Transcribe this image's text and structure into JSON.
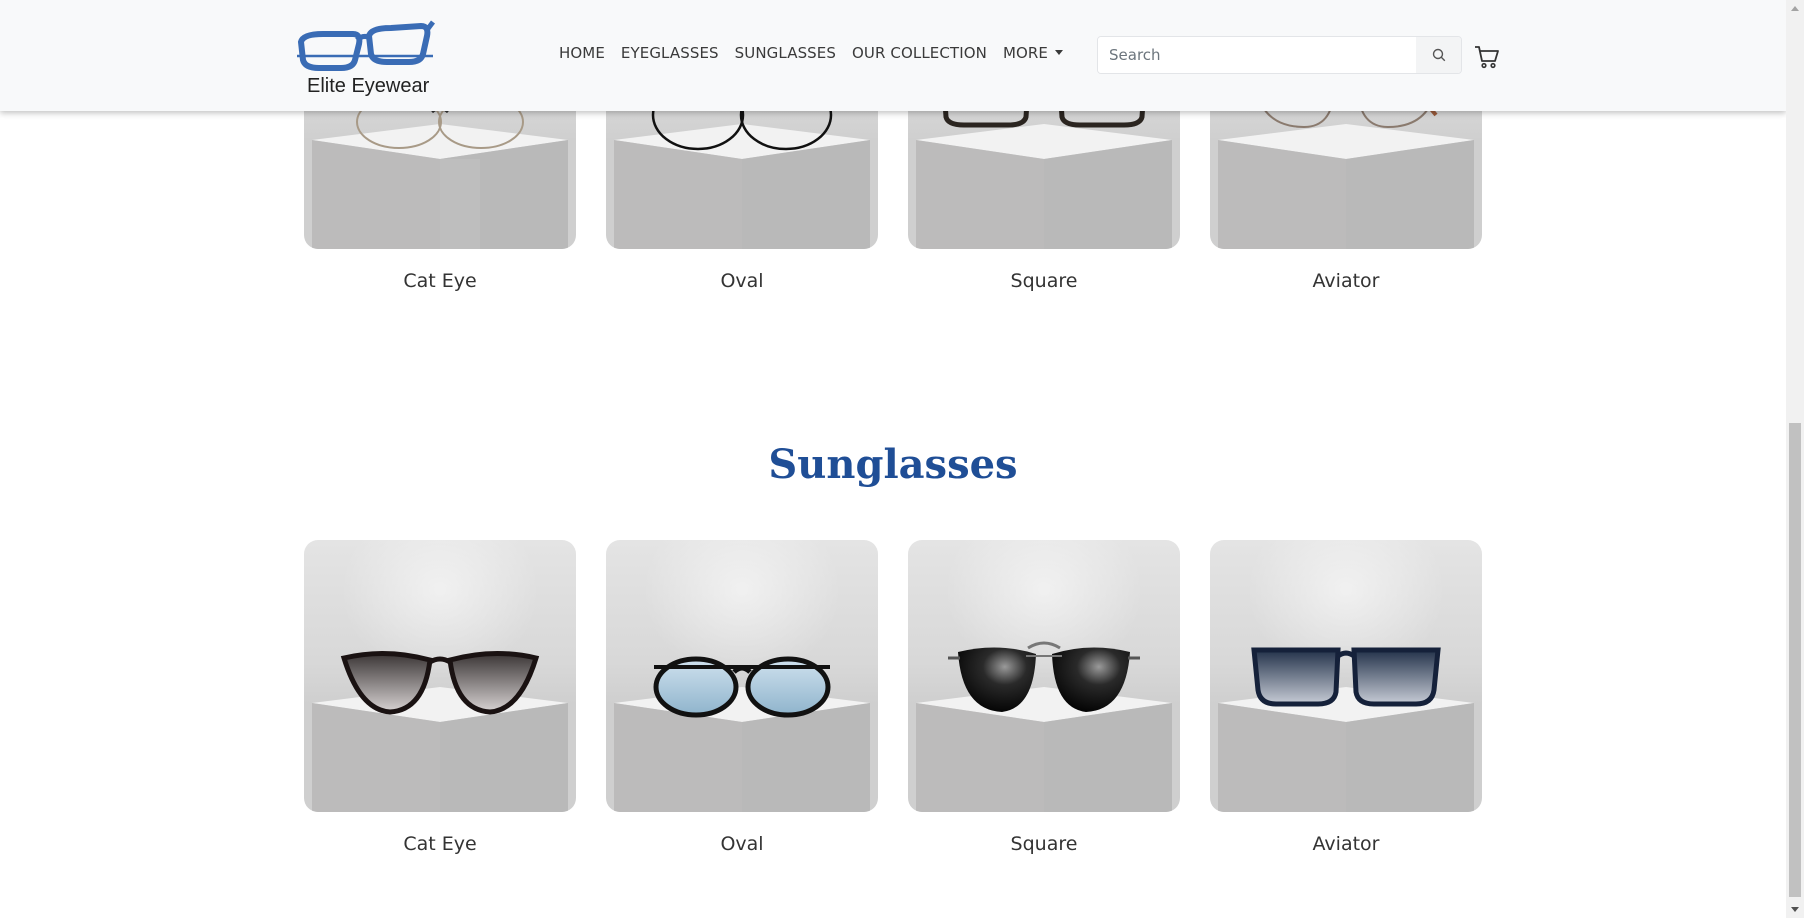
{
  "brand": {
    "name": "Elite Eyewear",
    "logo_icon": "glasses-logo",
    "logo_color": "#3a6cb5"
  },
  "nav": {
    "items": [
      {
        "label": "HOME"
      },
      {
        "label": "EYEGLASSES"
      },
      {
        "label": "SUNGLASSES"
      },
      {
        "label": "OUR COLLECTION"
      },
      {
        "label": "MORE"
      }
    ]
  },
  "search": {
    "placeholder": "Search",
    "value": "",
    "icon": "search-icon"
  },
  "cart": {
    "icon": "cart-icon"
  },
  "eyeglasses": {
    "cards": [
      {
        "label": "Cat Eye",
        "icon": "eyeglasses-cat-eye"
      },
      {
        "label": "Oval",
        "icon": "eyeglasses-oval"
      },
      {
        "label": "Square",
        "icon": "eyeglasses-square"
      },
      {
        "label": "Aviator",
        "icon": "eyeglasses-aviator"
      }
    ]
  },
  "sunglasses": {
    "title": "Sunglasses",
    "title_color": "#1f4e96",
    "cards": [
      {
        "label": "Cat Eye",
        "icon": "sunglasses-cat-eye"
      },
      {
        "label": "Oval",
        "icon": "sunglasses-oval"
      },
      {
        "label": "Square",
        "icon": "sunglasses-square"
      },
      {
        "label": "Aviator",
        "icon": "sunglasses-aviator"
      }
    ]
  }
}
